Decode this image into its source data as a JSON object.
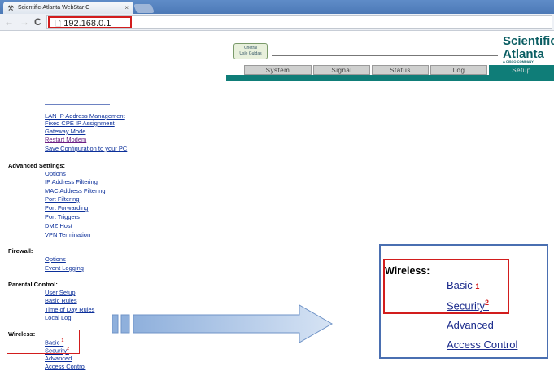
{
  "browser": {
    "tab_title": "Scientific-Atlanta WebStar C",
    "tab_close": "×",
    "url": "192.168.0.1",
    "back": "←",
    "forward": "→",
    "reload": "C"
  },
  "header": {
    "logo_line1": "Cnetral",
    "logo_line2": "Usle Guldas",
    "brand_line1": "Scientific",
    "brand_line2": "Atlanta",
    "brand_sub": "A CISCO COMPANY",
    "tabs": [
      "System",
      "Signal",
      "Status",
      "Log",
      "Setup"
    ],
    "active_tab": "Setup"
  },
  "menu": {
    "setup_links": [
      "LAN IP Address Management",
      "Fixed CPE IP Assignment",
      "Gateway Mode",
      "Restart Modem",
      "Save Configuration to your PC"
    ],
    "advanced_title": "Advanced Settings:",
    "advanced_links": [
      "Options",
      "IP Address Filtering",
      "MAC Address Filtering",
      "Port Filtering",
      "Port Forwarding",
      "Port Triggers",
      "DMZ Host",
      "VPN Termination"
    ],
    "firewall_title": "Firewall:",
    "firewall_links": [
      "Options",
      "Event Logging"
    ],
    "parental_title": "Parental Control:",
    "parental_links": [
      "User Setup",
      "Basic Rules",
      "Time of Day Rules",
      "Local Log"
    ],
    "wireless_title": "Wireless:",
    "wireless_links": [
      "Basic",
      "Security",
      "Advanced",
      "Access Control"
    ],
    "marker_1": "1",
    "marker_2": "2"
  },
  "colors": {
    "teal": "#0f7d78",
    "highlight_red": "#d21d1d",
    "link_blue": "#0b2f9a"
  }
}
